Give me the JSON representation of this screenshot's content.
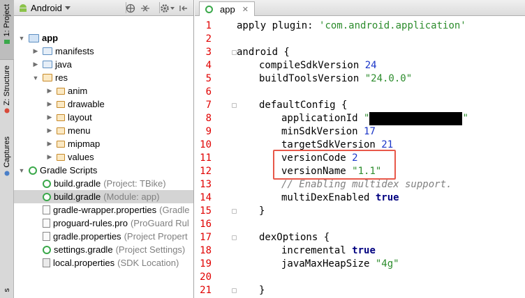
{
  "side_tabs": {
    "project": "1: Project",
    "structure": "Z: Structure",
    "captures": "Captures",
    "bottom": "s"
  },
  "project_panel": {
    "view_selector": "Android",
    "toolbar_icons": [
      "target-icon",
      "collapse-icon",
      "gear-icon",
      "hide-panel-icon"
    ]
  },
  "tree": [
    {
      "label": "app",
      "hint": "",
      "icon": "app-folder-icon",
      "arrow": "expanded",
      "bold": true
    },
    {
      "label": "manifests",
      "hint": "",
      "icon": "folder-icon",
      "arrow": "collapsed"
    },
    {
      "label": "java",
      "hint": "",
      "icon": "folder-icon",
      "arrow": "collapsed"
    },
    {
      "label": "res",
      "hint": "",
      "icon": "res-folder-icon",
      "arrow": "expanded"
    },
    {
      "label": "anim",
      "hint": "",
      "icon": "res-folder-icon",
      "arrow": "collapsed"
    },
    {
      "label": "drawable",
      "hint": "",
      "icon": "res-folder-icon",
      "arrow": "collapsed"
    },
    {
      "label": "layout",
      "hint": "",
      "icon": "res-folder-icon",
      "arrow": "collapsed"
    },
    {
      "label": "menu",
      "hint": "",
      "icon": "res-folder-icon",
      "arrow": "collapsed"
    },
    {
      "label": "mipmap",
      "hint": "",
      "icon": "res-folder-icon",
      "arrow": "collapsed"
    },
    {
      "label": "values",
      "hint": "",
      "icon": "res-folder-icon",
      "arrow": "collapsed"
    },
    {
      "label": "Gradle Scripts",
      "hint": "",
      "icon": "gradle-icon",
      "arrow": "expanded"
    },
    {
      "label": "build.gradle",
      "hint": "(Project: TBike)",
      "icon": "gradle-icon",
      "arrow": "none"
    },
    {
      "label": "build.gradle",
      "hint": "(Module: app)",
      "icon": "gradle-icon",
      "arrow": "none",
      "selected": true
    },
    {
      "label": "gradle-wrapper.properties",
      "hint": "(Gradle",
      "icon": "properties-file-icon",
      "arrow": "none"
    },
    {
      "label": "proguard-rules.pro",
      "hint": "(ProGuard Rul",
      "icon": "file-icon",
      "arrow": "none"
    },
    {
      "label": "gradle.properties",
      "hint": "(Project Propert",
      "icon": "properties-file-icon",
      "arrow": "none"
    },
    {
      "label": "settings.gradle",
      "hint": "(Project Settings)",
      "icon": "gradle-icon",
      "arrow": "none"
    },
    {
      "label": "local.properties",
      "hint": "(SDK Location)",
      "icon": "sdk-file-icon",
      "arrow": "none"
    }
  ],
  "editor": {
    "tab_label": "app",
    "line_numbers": [
      "1",
      "2",
      "3",
      "4",
      "5",
      "6",
      "7",
      "8",
      "9",
      "10",
      "11",
      "12",
      "13",
      "14",
      "15",
      "16",
      "17",
      "18",
      "19",
      "20",
      "21"
    ],
    "code": {
      "l1_a": "apply ",
      "l1_b": "plugin: ",
      "l1_c": "'com.android.application'",
      "l3": "android {",
      "l4_a": "compileSdkVersion ",
      "l4_b": "24",
      "l5_a": "buildToolsVersion ",
      "l5_b": "\"24.0.0\"",
      "l7": "defaultConfig {",
      "l8_a": "applicationId ",
      "l8_b": "\"",
      "l8_c": "\"",
      "l9_a": "minSdkVersion ",
      "l9_b": "17",
      "l10_a": "targetSdkVersion ",
      "l10_b": "21",
      "l11_a": "versionCode ",
      "l11_b": "2",
      "l12_a": "versionName ",
      "l12_b": "\"1.1\"",
      "l13": "// Enabling multidex support.",
      "l14_a": "multiDexEnabled ",
      "l14_b": "true",
      "l15": "}",
      "l17": "dexOptions {",
      "l18_a": "incremental ",
      "l18_b": "true",
      "l19_a": "javaMaxHeapSize ",
      "l19_b": "\"4g\"",
      "l21": "}"
    }
  }
}
